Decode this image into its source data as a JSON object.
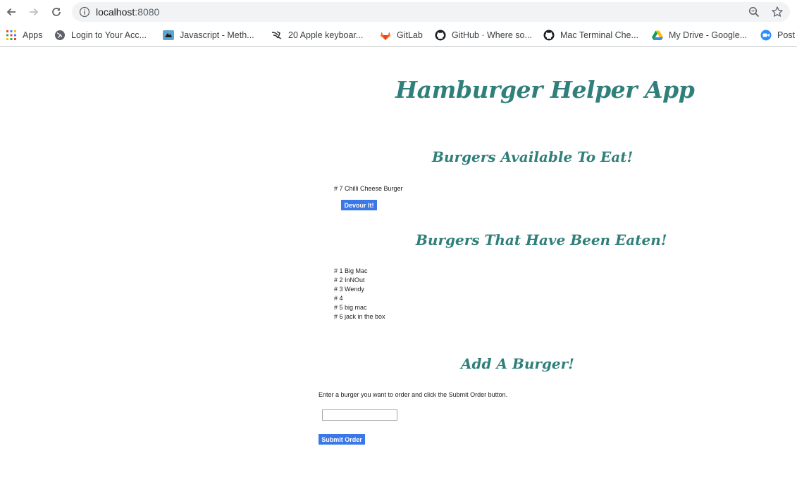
{
  "browser": {
    "url_host": "localhost",
    "url_port": ":8080",
    "bookmarks": [
      {
        "label": "Apps",
        "icon": "apps-grid-icon"
      },
      {
        "label": "Login to Your Acc...",
        "icon": "globe-icon"
      },
      {
        "label": "Javascript - Meth...",
        "icon": "javascript-site-icon"
      },
      {
        "label": "20 Apple keyboar...",
        "icon": "bird-logo-icon"
      },
      {
        "label": "GitLab",
        "icon": "gitlab-icon"
      },
      {
        "label": "GitHub · Where so...",
        "icon": "github-icon"
      },
      {
        "label": "Mac Terminal Che...",
        "icon": "github-icon"
      },
      {
        "label": "My Drive - Google...",
        "icon": "google-drive-icon"
      },
      {
        "label": "Post",
        "icon": "zoom-video-icon"
      }
    ]
  },
  "app": {
    "title": "Hamburger Helper App",
    "available": {
      "heading": "Burgers Available To Eat!",
      "items": [
        {
          "text": "# 7 Chilli Cheese Burger",
          "button": "Devour It!"
        }
      ]
    },
    "eaten": {
      "heading": "Burgers That Have Been Eaten!",
      "items": [
        "# 1 Big Mac",
        "# 2 InNOut",
        "# 3 Wendy",
        "# 4",
        "# 5 big mac",
        "# 6 jack in the box"
      ]
    },
    "add": {
      "heading": "Add A Burger!",
      "instructions": "Enter a burger you want to order and click the Submit Order button.",
      "input_value": "",
      "input_placeholder": "",
      "submit_label": "Submit Order"
    }
  },
  "colors": {
    "heading": "#2f7f7a",
    "button": "#3b78e7"
  }
}
